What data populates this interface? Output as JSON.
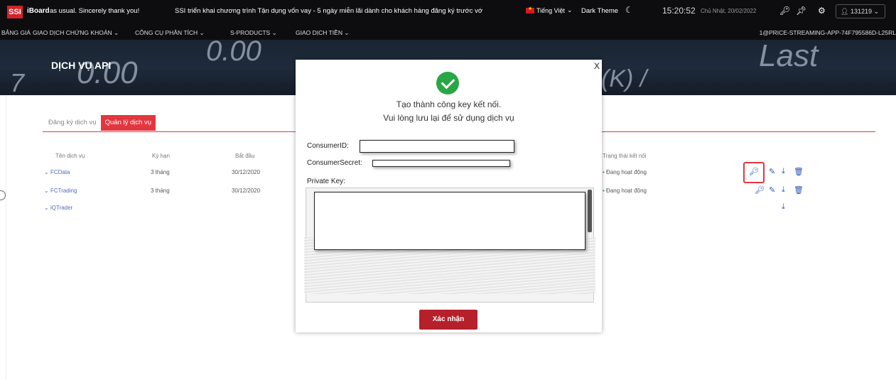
{
  "header": {
    "logo": "SSI",
    "brand": "iBoard",
    "marquee_text": "as usual. Sincerely thank you!",
    "announcement": "SSI triển khai chương trình Tận dụng vốn vay - 5 ngày miễn lãi dành cho khách hàng đăng ký trước vớ",
    "language": "Tiếng Việt",
    "theme_label": "Dark Theme",
    "clock": "15:20:52",
    "date": "Chủ Nhật, 20/02/2022",
    "user": "131219"
  },
  "nav": {
    "items": [
      "BẢNG GIÁ",
      "GIAO DỊCH CHỨNG KHOÁN",
      "CÔNG CỤ PHÂN TÍCH",
      "S-PRODUCTS",
      "GIAO DỊCH TIỀN"
    ],
    "stream_id": "1@PRICE-STREAMING-APP-74F795586D-L25RL"
  },
  "banner": {
    "title": "DỊCH VỤ API",
    "deco": [
      "0.00",
      "0.00",
      "Last",
      "(K) /",
      "7"
    ]
  },
  "tabs": {
    "register": "Đăng ký dịch vụ",
    "manage": "Quản lý dịch vụ"
  },
  "table": {
    "headers": [
      "Tên dịch vụ",
      "Kỳ hạn",
      "Bắt đầu",
      "Trạng thái kết nối"
    ],
    "rows": [
      {
        "name": "FCData",
        "term": "3 tháng",
        "start": "30/12/2020",
        "status": "Đang hoạt động"
      },
      {
        "name": "FCTrading",
        "term": "3 tháng",
        "start": "30/12/2020",
        "status": "Đang hoạt động"
      },
      {
        "name": "iQTrader",
        "term": "",
        "start": "",
        "status": ""
      }
    ]
  },
  "modal": {
    "close": "X",
    "line1": "Tạo thành công key kết nối.",
    "line2": "Vui lòng lưu lại để sử dụng dịch vụ",
    "consumer_id_label": "ConsumerID:",
    "consumer_secret_label": "ConsumerSecret:",
    "private_key_label": "Private Key:",
    "confirm_label": "Xác nhận"
  },
  "icons": {
    "key": "key-icon",
    "edit": "pencil-icon",
    "download": "download-icon",
    "delete": "trash-icon"
  },
  "colors": {
    "accent": "#e4363f",
    "confirm": "#b5202a",
    "success": "#28a745",
    "link": "#4b6ebe"
  }
}
